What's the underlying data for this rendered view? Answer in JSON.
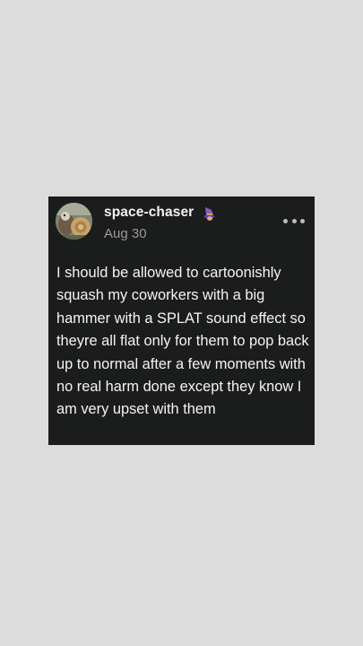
{
  "post": {
    "username": "space-chaser",
    "date": "Aug 30",
    "body": "I should be allowed to cartoonishly squash my coworkers with a big hammer with a SPLAT sound effect so theyre all flat only for them to pop back up to normal after a few moments with no real harm done except they know I am very upset with them",
    "avatar_icon": "squirrel-avatar",
    "badge_icon": "witch-hat-icon",
    "menu_icon": "more-options-icon"
  },
  "colors": {
    "page_background": "#dcdcdc",
    "card_background": "#1b1c1c",
    "text_primary": "#f4f4f4",
    "text_secondary": "#9a9a9a",
    "badge_purple": "#8e5bbd"
  }
}
